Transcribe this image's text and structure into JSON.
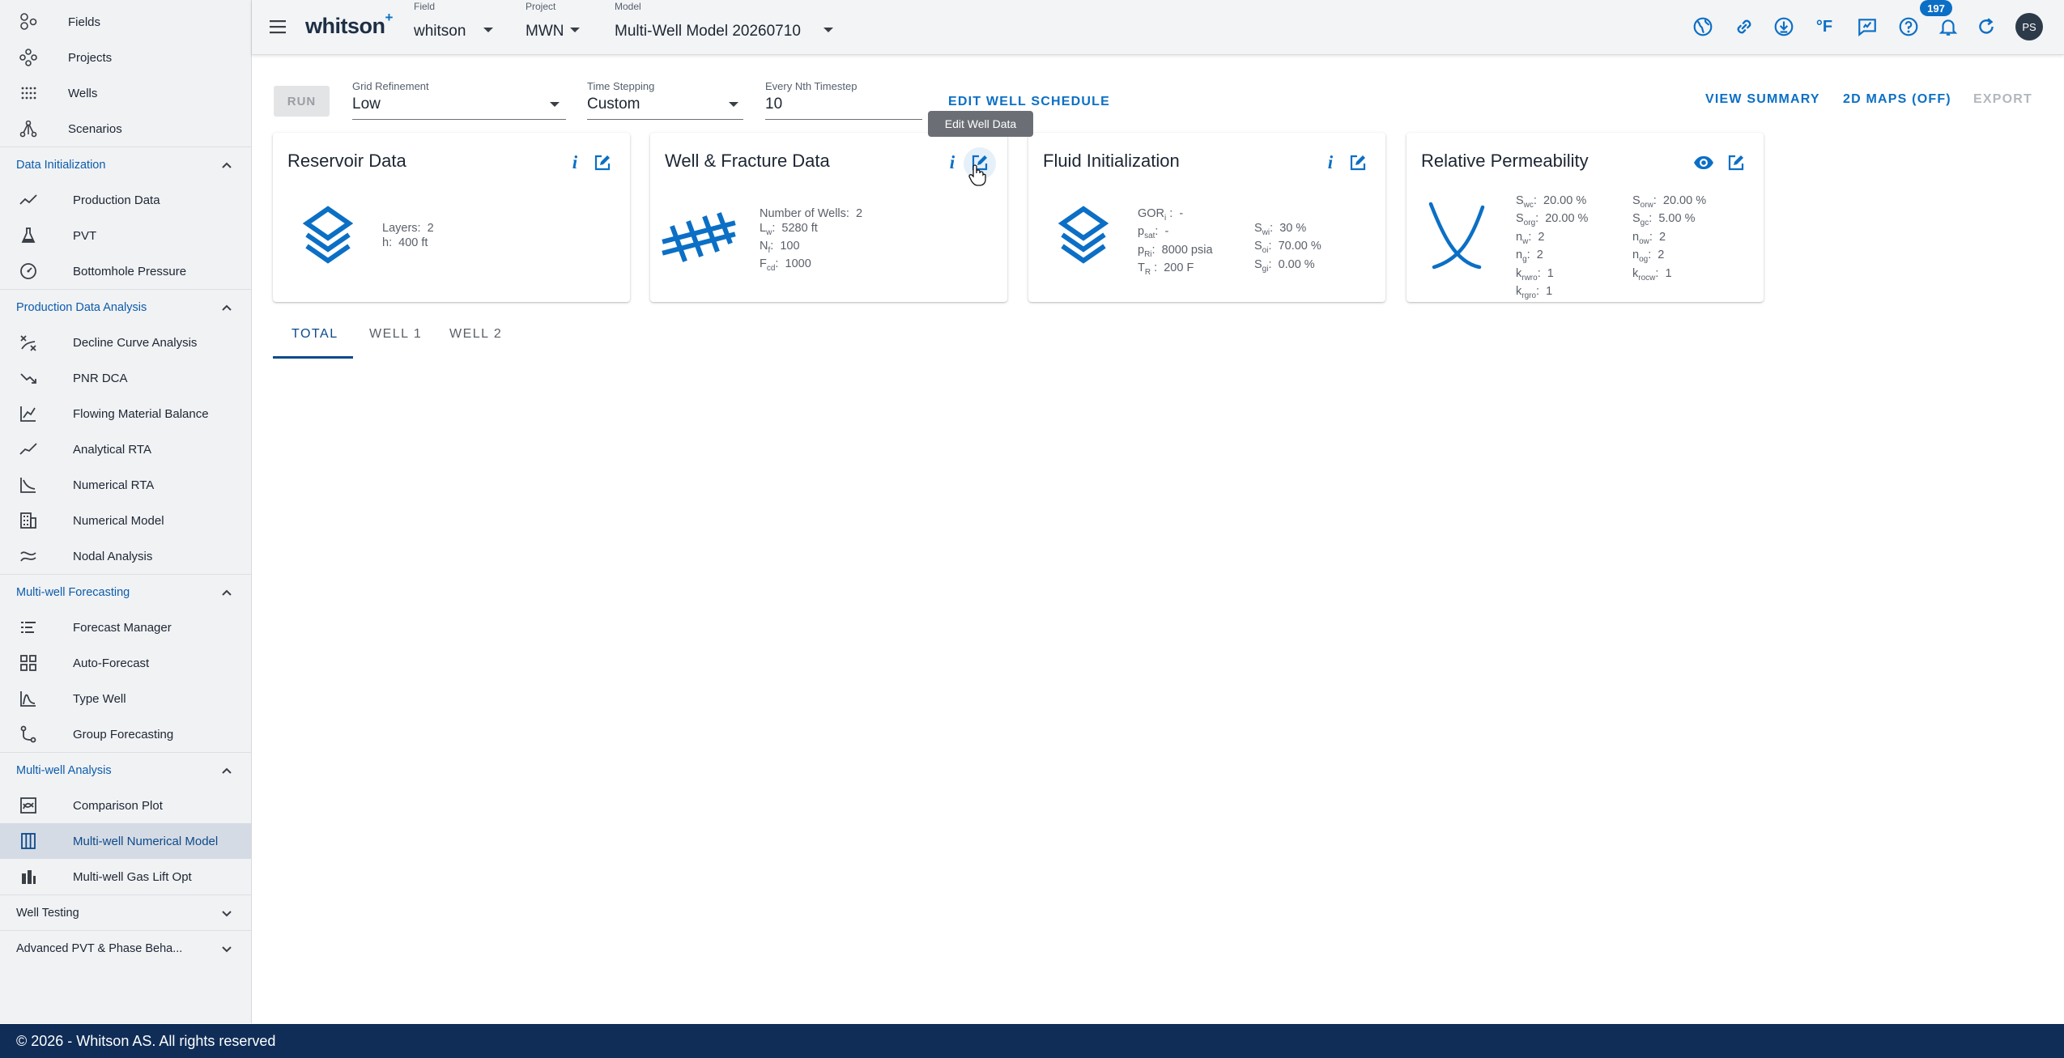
{
  "sidebar": {
    "top_items": [
      {
        "label": "Fields",
        "icon": "fields-icon"
      },
      {
        "label": "Projects",
        "icon": "projects-icon"
      },
      {
        "label": "Wells",
        "icon": "wells-icon"
      },
      {
        "label": "Scenarios",
        "icon": "scenarios-icon"
      }
    ],
    "sections": [
      {
        "label": "Data Initialization",
        "expanded": true,
        "items": [
          "Production Data",
          "PVT",
          "Bottomhole Pressure"
        ]
      },
      {
        "label": "Production Data Analysis",
        "expanded": true,
        "items": [
          "Decline Curve Analysis",
          "PNR DCA",
          "Flowing Material Balance",
          "Analytical RTA",
          "Numerical RTA",
          "Numerical Model",
          "Nodal Analysis"
        ]
      },
      {
        "label": "Multi-well Forecasting",
        "expanded": true,
        "items": [
          "Forecast Manager",
          "Auto-Forecast",
          "Type Well",
          "Group Forecasting"
        ]
      },
      {
        "label": "Multi-well Analysis",
        "expanded": true,
        "items": [
          "Comparison Plot",
          "Multi-well Numerical Model",
          "Multi-well Gas Lift Opt"
        ]
      },
      {
        "label": "Well Testing",
        "expanded": false,
        "items": []
      },
      {
        "label": "Advanced PVT & Phase Beha...",
        "expanded": false,
        "items": []
      }
    ],
    "active_item": "Multi-well Numerical Model"
  },
  "header": {
    "brand": "whitson",
    "brand_sup": "+",
    "field_caption": "Field",
    "field_value": "whitson",
    "project_caption": "Project",
    "project_value": "MWN",
    "model_caption": "Model",
    "model_value": "Multi-Well Model 20260710",
    "notification_count": "197",
    "avatar_initials": "PS",
    "icons": [
      "globe-icon",
      "link-icon",
      "download-icon",
      "temperature-unit-icon",
      "feedback-icon",
      "help-icon",
      "notifications-icon",
      "refresh-icon"
    ],
    "temperature_unit": "°F"
  },
  "toolbar": {
    "run_label": "RUN",
    "grid_refinement_caption": "Grid Refinement",
    "grid_refinement_value": "Low",
    "time_stepping_caption": "Time Stepping",
    "time_stepping_value": "Custom",
    "nth_timestep_caption": "Every Nth Timestep",
    "nth_timestep_value": "10",
    "edit_schedule_label": "EDIT WELL SCHEDULE",
    "view_summary_label": "VIEW SUMMARY",
    "maps_label": "2D MAPS (OFF)",
    "export_label": "EXPORT"
  },
  "cards": {
    "reservoir": {
      "title": "Reservoir Data",
      "layers_label": "Layers:",
      "layers_value": "2",
      "h_label": "h:",
      "h_value": "400 ft"
    },
    "well": {
      "title": "Well & Fracture Data",
      "num_wells_label": "Number of Wells:",
      "num_wells_value": "2",
      "lw_value": "5280 ft",
      "nf_value": "100",
      "fcd_value": "1000",
      "tooltip": "Edit Well Data"
    },
    "fluid": {
      "title": "Fluid Initialization",
      "gor_value": "-",
      "psat_value": "-",
      "pri_value": "8000 psia",
      "tr_value": "200 F",
      "swi_value": "30 %",
      "soi_value": "70.00 %",
      "sgi_value": "0.00 %"
    },
    "relperm": {
      "title": "Relative Permeability",
      "swc": "20.00 %",
      "sorg": "20.00 %",
      "nw": "2",
      "ng": "2",
      "krwro": "1",
      "krgro": "1",
      "sorw": "20.00 %",
      "sgc": "5.00 %",
      "now": "2",
      "nog": "2",
      "krocw": "1"
    }
  },
  "tabs": [
    "TOTAL",
    "WELL 1",
    "WELL 2"
  ],
  "footer": {
    "text": "© 2026 - Whitson AS. All rights reserved"
  },
  "colors": {
    "accent": "#0b6fc5",
    "dark_blue": "#0f2d57",
    "sidebar_bg": "#f1f2f4"
  }
}
